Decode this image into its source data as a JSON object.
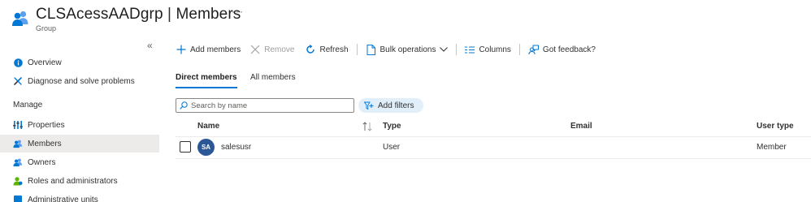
{
  "header": {
    "title_main": "CLSAcessAADgrp",
    "title_separator": "|",
    "title_page": "Members",
    "subtitle": "Group",
    "more_icon": "ellipsis-icon",
    "icon": "group-icon"
  },
  "sidebar": {
    "collapse_icon": "double-chevron-left-icon",
    "section_label": "Manage",
    "top_items": [
      {
        "label": "Overview",
        "icon": "info-icon"
      },
      {
        "label": "Diagnose and solve problems",
        "icon": "wrench-icon"
      }
    ],
    "manage_items": [
      {
        "label": "Properties",
        "icon": "properties-icon"
      },
      {
        "label": "Members",
        "icon": "members-icon",
        "selected": true
      },
      {
        "label": "Owners",
        "icon": "owners-icon"
      },
      {
        "label": "Roles and administrators",
        "icon": "roles-icon"
      },
      {
        "label": "Administrative units",
        "icon": "admin-units-icon"
      }
    ]
  },
  "toolbar": {
    "add_members": "Add members",
    "remove": "Remove",
    "refresh": "Refresh",
    "bulk_operations": "Bulk operations",
    "columns": "Columns",
    "got_feedback": "Got feedback?"
  },
  "tabs": [
    {
      "label": "Direct members",
      "active": true
    },
    {
      "label": "All members",
      "active": false
    }
  ],
  "search": {
    "placeholder": "Search by name",
    "value": ""
  },
  "filters": {
    "label": "Add filters"
  },
  "table": {
    "columns": [
      "Name",
      "Type",
      "Email",
      "User type"
    ],
    "rows": [
      {
        "initials": "SA",
        "name": "salesusr",
        "type": "User",
        "email": "",
        "user_type": "Member"
      }
    ]
  },
  "colors": {
    "accent": "#0078d4",
    "avatar": "#2b5797",
    "selected_nav": "#edebe9",
    "filter_pill": "#e1effa"
  }
}
